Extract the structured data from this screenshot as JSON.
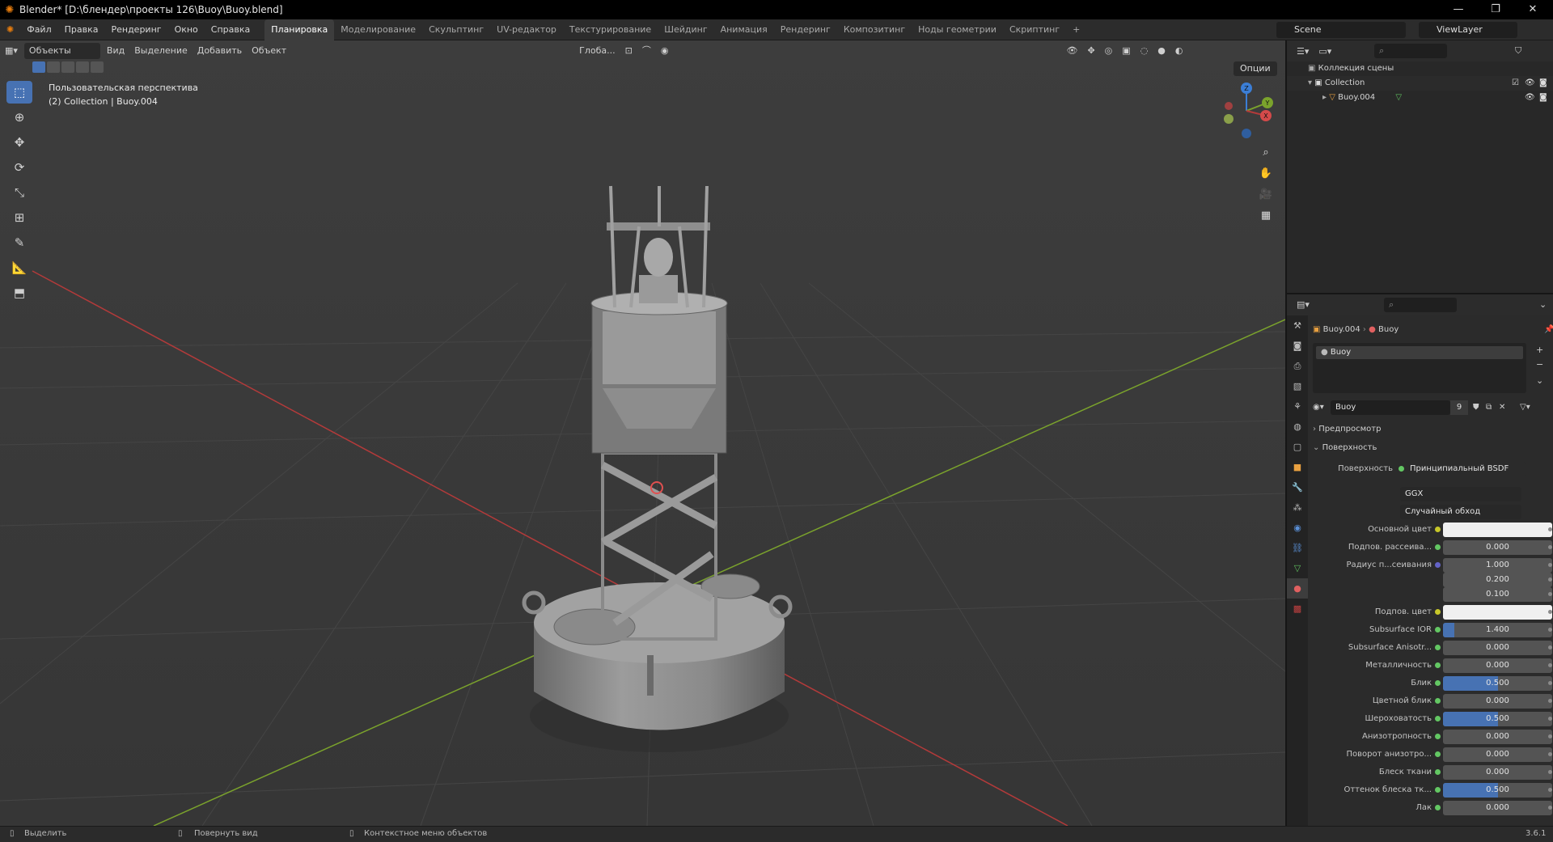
{
  "window": {
    "title": "Blender* [D:\\блендер\\проекты 126\\Buoy\\Buoy.blend]"
  },
  "menu": [
    "Файл",
    "Правка",
    "Рендеринг",
    "Окно",
    "Справка"
  ],
  "workspaces": [
    "Планировка",
    "Моделирование",
    "Скульптинг",
    "UV-редактор",
    "Текстурирование",
    "Шейдинг",
    "Анимация",
    "Рендеринг",
    "Композитинг",
    "Ноды геометрии",
    "Скриптинг"
  ],
  "workspace_add": "+",
  "scene": {
    "name": "Scene",
    "view_layer": "ViewLayer"
  },
  "viewport": {
    "mode": "Объекты",
    "menus": [
      "Вид",
      "Выделение",
      "Добавить",
      "Объект"
    ],
    "orientation": "Глоба...",
    "options_label": "Опции",
    "info_line1": "Пользовательская перспектива",
    "info_line2": "(2) Collection | Buoy.004",
    "gizmo_axes": {
      "x": "X",
      "y": "Y",
      "z": "Z"
    }
  },
  "outliner": {
    "root": "Коллекция сцены",
    "collection": "Collection",
    "object": "Buoy.004"
  },
  "properties": {
    "breadcrumb_object": "Buoy.004",
    "breadcrumb_material": "Buoy",
    "slot_name": "Buoy",
    "material_name": "Buoy",
    "users_count": "9",
    "section_preview": "Предпросмотр",
    "section_surface": "Поверхность",
    "surface_label": "Поверхность",
    "surface_value": "Принципиальный BSDF",
    "distribution": "GGX",
    "subsurface_method": "Случайный обход",
    "rows": [
      {
        "label": "Основной цвет",
        "value": "",
        "kind": "color"
      },
      {
        "label": "Подпов. рассеива...",
        "value": "0.000",
        "kind": "num",
        "fill": 0
      },
      {
        "label": "Радиус п...сеивания",
        "value": "1.000",
        "kind": "num",
        "fill": 0,
        "dot": "b"
      },
      {
        "label": "",
        "value": "0.200",
        "kind": "num",
        "fill": 0,
        "nodot": true
      },
      {
        "label": "",
        "value": "0.100",
        "kind": "num",
        "fill": 0,
        "nodot": true
      },
      {
        "label": "Подпов. цвет",
        "value": "",
        "kind": "color"
      },
      {
        "label": "Subsurface IOR",
        "value": "1.400",
        "kind": "num",
        "fill": 0.1
      },
      {
        "label": "Subsurface Anisotr...",
        "value": "0.000",
        "kind": "num",
        "fill": 0
      },
      {
        "label": "Металличность",
        "value": "0.000",
        "kind": "num",
        "fill": 0
      },
      {
        "label": "Блик",
        "value": "0.500",
        "kind": "num",
        "fill": 0.5
      },
      {
        "label": "Цветной блик",
        "value": "0.000",
        "kind": "num",
        "fill": 0
      },
      {
        "label": "Шероховатость",
        "value": "0.500",
        "kind": "num",
        "fill": 0.5
      },
      {
        "label": "Анизотропность",
        "value": "0.000",
        "kind": "num",
        "fill": 0
      },
      {
        "label": "Поворот анизотро...",
        "value": "0.000",
        "kind": "num",
        "fill": 0
      },
      {
        "label": "Блеск ткани",
        "value": "0.000",
        "kind": "num",
        "fill": 0
      },
      {
        "label": "Оттенок блеска тк...",
        "value": "0.500",
        "kind": "num",
        "fill": 0.5
      },
      {
        "label": "Лак",
        "value": "0.000",
        "kind": "num",
        "fill": 0
      }
    ]
  },
  "status": {
    "select": "Выделить",
    "rotate": "Повернуть вид",
    "context": "Контекстное меню объектов",
    "version": "3.6.1"
  },
  "colors": {
    "accent": "#4772b3",
    "x_axis": "#b33a3a",
    "y_axis": "#7ba32c",
    "z_axis": "#3b7ed6"
  }
}
